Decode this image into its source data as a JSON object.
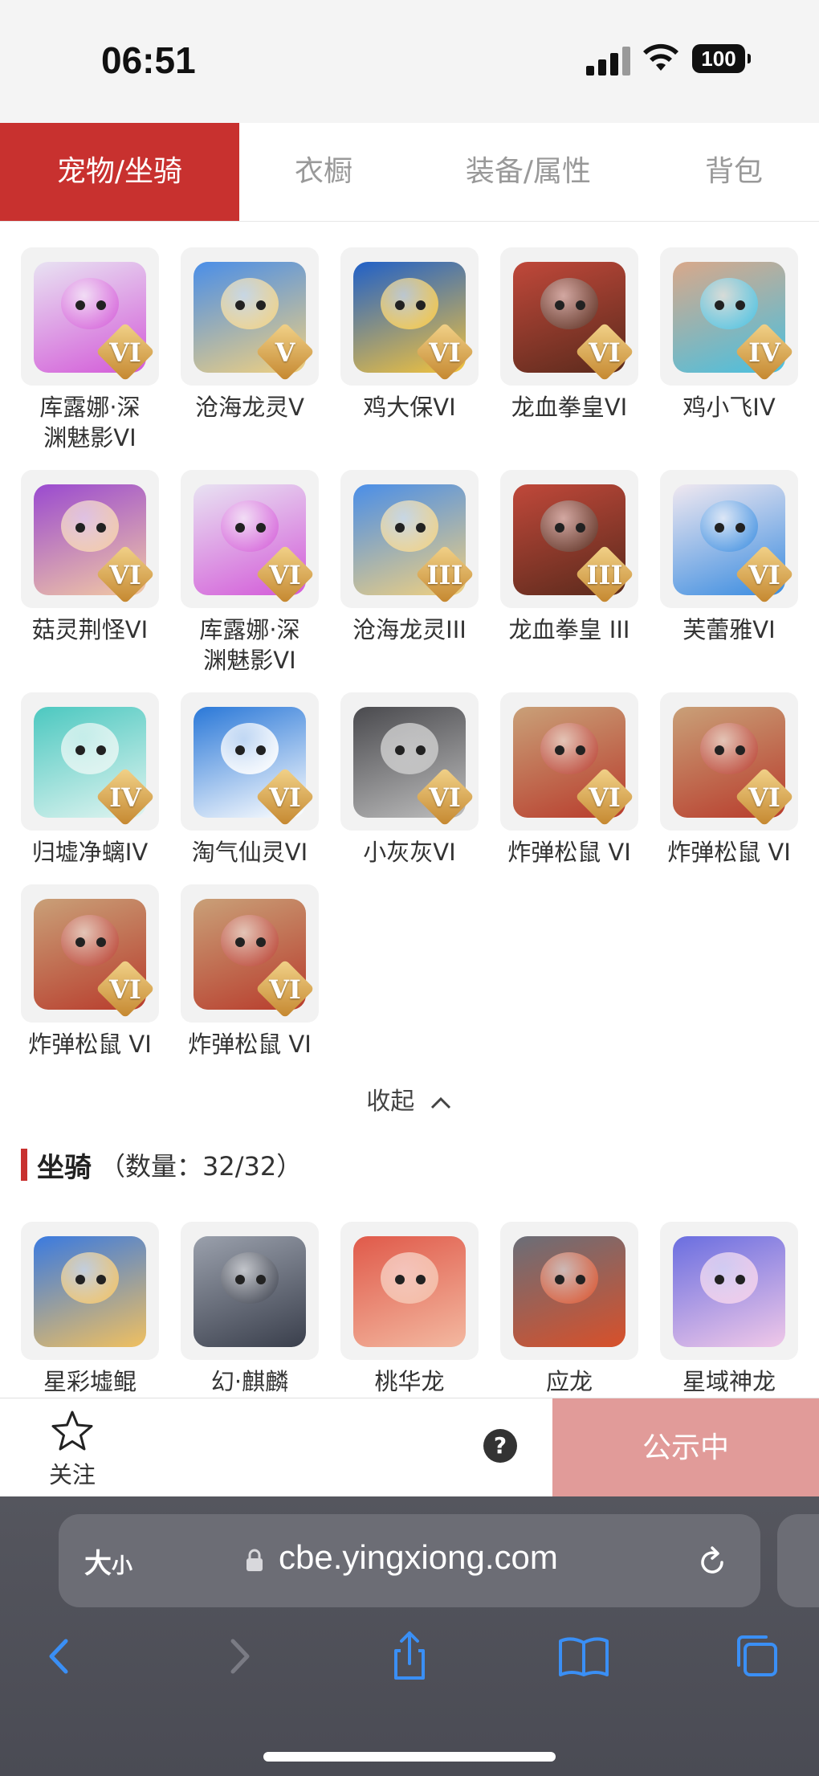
{
  "status_bar": {
    "time": "06:51",
    "battery": "100"
  },
  "tabs": [
    {
      "label": "宠物/坐骑",
      "active": true
    },
    {
      "label": "衣橱",
      "active": false
    },
    {
      "label": "装备/属性",
      "active": false
    },
    {
      "label": "背包",
      "active": false
    }
  ],
  "pets": [
    {
      "name": "库露娜·深渊魅影VI",
      "line1": "库露娜·深",
      "line2": "渊魅影VI",
      "level": "VI",
      "color": "#e8e2f2",
      "accent": "#d35ad8"
    },
    {
      "name": "沧海龙灵V",
      "line1": "沧海龙灵V",
      "line2": "",
      "level": "V",
      "color": "#4a8ee8",
      "accent": "#f0d080"
    },
    {
      "name": "鸡大保VI",
      "line1": "鸡大保VI",
      "line2": "",
      "level": "VI",
      "color": "#2060c8",
      "accent": "#f3c33c"
    },
    {
      "name": "龙血拳皇VI",
      "line1": "龙血拳皇VI",
      "line2": "",
      "level": "VI",
      "color": "#c0483a",
      "accent": "#5a2a1c"
    },
    {
      "name": "鸡小飞IV",
      "line1": "鸡小飞IV",
      "line2": "",
      "level": "IV",
      "color": "#d9a88a",
      "accent": "#48c0e0"
    },
    {
      "name": "菇灵荆怪VI",
      "line1": "菇灵荆怪VI",
      "line2": "",
      "level": "VI",
      "color": "#9a4ad0",
      "accent": "#f2c9a4"
    },
    {
      "name": "库露娜·深渊魅影VI",
      "line1": "库露娜·深",
      "line2": "渊魅影VI",
      "level": "VI",
      "color": "#e8e2f2",
      "accent": "#d35ad8"
    },
    {
      "name": "沧海龙灵III",
      "line1": "沧海龙灵III",
      "line2": "",
      "level": "III",
      "color": "#4a8ee8",
      "accent": "#f0d080"
    },
    {
      "name": "龙血拳皇 III",
      "line1": "龙血拳皇 III",
      "line2": "",
      "level": "III",
      "color": "#c0483a",
      "accent": "#5a2a1c"
    },
    {
      "name": "芙蕾雅VI",
      "line1": "芙蕾雅VI",
      "line2": "",
      "level": "VI",
      "color": "#f0e8f0",
      "accent": "#3a8ce0"
    },
    {
      "name": "归墟净螭IV",
      "line1": "归墟净螭IV",
      "line2": "",
      "level": "IV",
      "color": "#4cc8c0",
      "accent": "#e0f4f0"
    },
    {
      "name": "淘气仙灵VI",
      "line1": "淘气仙灵VI",
      "line2": "",
      "level": "VI",
      "color": "#2a78d8",
      "accent": "#ffffff"
    },
    {
      "name": "小灰灰VI",
      "line1": "小灰灰VI",
      "line2": "",
      "level": "VI",
      "color": "#4a4a4e",
      "accent": "#bdbdbd"
    },
    {
      "name": "炸弹松鼠 VI",
      "line1": "炸弹松鼠 VI",
      "line2": "",
      "level": "VI",
      "color": "#c9a078",
      "accent": "#b83c2c"
    },
    {
      "name": "炸弹松鼠 VI",
      "line1": "炸弹松鼠 VI",
      "line2": "",
      "level": "VI",
      "color": "#c9a078",
      "accent": "#b83c2c"
    },
    {
      "name": "炸弹松鼠 VI",
      "line1": "炸弹松鼠 VI",
      "line2": "",
      "level": "VI",
      "color": "#c9a078",
      "accent": "#b83c2c"
    },
    {
      "name": "炸弹松鼠 VI",
      "line1": "炸弹松鼠 VI",
      "line2": "",
      "level": "VI",
      "color": "#c9a078",
      "accent": "#b83c2c"
    }
  ],
  "collapse_label": "收起",
  "mounts_section": {
    "title": "坐骑",
    "count_label": "（数量：",
    "count": "32/32",
    "count_close": "）"
  },
  "mounts": [
    {
      "name": "星彩墟鲲",
      "color": "#3a7ae0",
      "accent": "#f0c060"
    },
    {
      "name": "幻·麒麟",
      "color": "#9aa0ac",
      "accent": "#3a3f4c"
    },
    {
      "name": "桃华龙",
      "color": "#e05a4a",
      "accent": "#f3b8a0"
    },
    {
      "name": "应龙",
      "color": "#6a6e78",
      "accent": "#d8502a"
    },
    {
      "name": "星域神龙",
      "color": "#6a6ee0",
      "accent": "#f0c8e8"
    }
  ],
  "bottom_bar": {
    "follow_label": "关注",
    "help": "?",
    "status_button": "公示中"
  },
  "browser": {
    "text_size_label": "大",
    "text_size_small": "小",
    "url": "cbe.yingxiong.com"
  },
  "colors": {
    "brand_red": "#c8312f",
    "public_button": "#e19b99"
  },
  "icons": [
    "star-icon",
    "help-icon",
    "lock-icon",
    "reload-icon",
    "back-icon",
    "forward-icon",
    "share-icon",
    "bookmarks-icon",
    "tabs-icon",
    "chevron-up-icon"
  ]
}
